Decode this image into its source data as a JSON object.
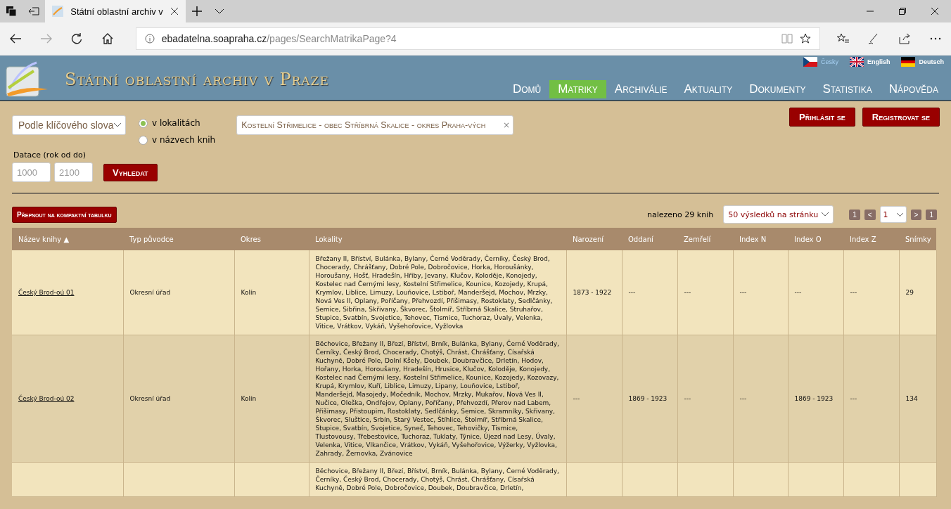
{
  "browser": {
    "tab_title": "Státní oblastní archiv v",
    "address_host": "ebadatelna.soapraha.cz",
    "address_path": "/pages/SearchMatrikaPage?4"
  },
  "header": {
    "site_title": "Státní oblastní archiv v Praze",
    "languages": [
      {
        "label": "Česky",
        "selected": true
      },
      {
        "label": "English",
        "selected": false
      },
      {
        "label": "Deutsch",
        "selected": false
      }
    ],
    "nav": [
      {
        "label": "Domů",
        "selected": false
      },
      {
        "label": "Matriky",
        "selected": true
      },
      {
        "label": "Archiválie",
        "selected": false
      },
      {
        "label": "Aktuality",
        "selected": false
      },
      {
        "label": "Dokumenty",
        "selected": false
      },
      {
        "label": "Statistika",
        "selected": false
      },
      {
        "label": "Nápověda",
        "selected": false
      }
    ]
  },
  "search": {
    "mode": "Podle klíčového slova",
    "scope": [
      {
        "label": "v lokalitách",
        "selected": true
      },
      {
        "label": "v názvech knih",
        "selected": false
      }
    ],
    "term": "Kostelní Střimelice - obec Stříbrná Skalice - okres Praha-vých",
    "clear": "×",
    "date_label": "Datace (rok od do)",
    "from_placeholder": "1000",
    "to_placeholder": "2100",
    "search_button": "Vyhledat",
    "login_button": "Přihlásit se",
    "register_button": "Registrovat se"
  },
  "results": {
    "compact_button": "Přepnout na kompaktní tabulku",
    "found": "nalezeno 29 knih",
    "per_page": "50 výsledků na stránku",
    "first": "1",
    "prev": "<",
    "page": "1",
    "next": ">",
    "last": "1"
  },
  "table": {
    "columns": [
      "Název knihy ▲",
      "Typ původce",
      "Okres",
      "Lokality",
      "Narození",
      "Oddaní",
      "Zemřelí",
      "Index N",
      "Index O",
      "Index Z",
      "Snímky"
    ],
    "rows": [
      {
        "cells": [
          "Český Brod-oú 01",
          "Okresní úřad",
          "Kolín",
          "Břežany II, Bříství, Bulánka, Bylany, Černé Voděrady, Černíky, Český Brod, Chocerady, Chrášťany, Dobré Pole, Dobročovice, Horka, Horoušánky, Horoušany, Hošť, Hradešín, Hřiby, Jevany, Klučov, Koloděje, Konojedy, Kostelec nad Černými lesy, Kostelní Střimelice, Kounice, Kozojedy, Krupá, Krymlov, Liblice, Limuzy, Louňovice, Lstiboř, Manderšejd, Mochov, Mrzky, Nová Ves II, Oplany, Poříčany, Přehvozdí, Přišimasy, Rostoklaty, Sedlčánky, Semice, Sibřina, Skřivany, Škvorec, Štolmíř, Stříbrná Skalice, Struhařov, Stupice, Svatbín, Svojetice, Tehovec, Tismice, Tuchoraz, Úvaly, Velenka, Vitice, Vrátkov, Vykáň, Vyšehořovice, Vyžlovka",
          "1873 - 1922",
          "---",
          "---",
          "---",
          "---",
          "---",
          "29"
        ]
      },
      {
        "cells": [
          "Český Brod-oú 02",
          "Okresní úřad",
          "Kolín",
          "Běchovice, Břežany II, Březí, Bříství, Brník, Bulánka, Bylany, Černé Voděrady, Černíky, Český Brod, Chocerady, Chotýš, Chrást, Chrášťany, Císařská Kuchyně, Dobré Pole, Dolní Kšely, Doubek, Doubravčice, Drletín, Hodov, Hořany, Horka, Horoušany, Hradešín, Hrusice, Klučov, Koloděje, Konojedy, Kostelec nad Černými lesy, Kostelní Střimelice, Kounice, Kozojedy, Kozovazy, Krupá, Krymlov, Kuří, Liblice, Limuzy, Lipany, Louňovice, Lstiboř, Manderšejd, Masojedy, Močedník, Mochov, Mrzky, Mukařov, Nová Ves II, Nučice, Oleška, Ondřejov, Oplany, Poříčany, Přehvozdí, Přerov nad Labem, Přišimasy, Přistoupim, Rostoklaty, Sedlčánky, Semice, Skramníky, Skřivany, Škvorec, Sluštice, Srbín, Starý Vestec, Štíhlice, Štolmíř, Stříbrná Skalice, Stupice, Svatbín, Svojetice, Syneč, Tehovec, Tehovičky, Tismice, Tlustovousy, Třebestovice, Tuchoraz, Tuklaty, Týnice, Újezd nad Lesy, Úvaly, Velenka, Vitice, Vlkančice, Vrátkov, Vykáň, Vyšehořovice, Výžerky, Vyžlovka, Zahrady, Žernovka, Zvánovice",
          "---",
          "1869 - 1923",
          "---",
          "---",
          "1869 - 1923",
          "---",
          "134"
        ]
      },
      {
        "cells": [
          "",
          "",
          "",
          "Běchovice, Břežany II, Březí, Bříství, Brník, Bulánka, Bylany, Černé Voděrady, Černíky, Český Brod, Chocerady, Chotýš, Chrást, Chrášťany, Císařská Kuchyně, Dobré Pole, Dobročovice, Doubek, Doubravčice, Drletín,",
          "",
          "",
          "",
          "",
          "",
          "",
          ""
        ]
      }
    ]
  }
}
